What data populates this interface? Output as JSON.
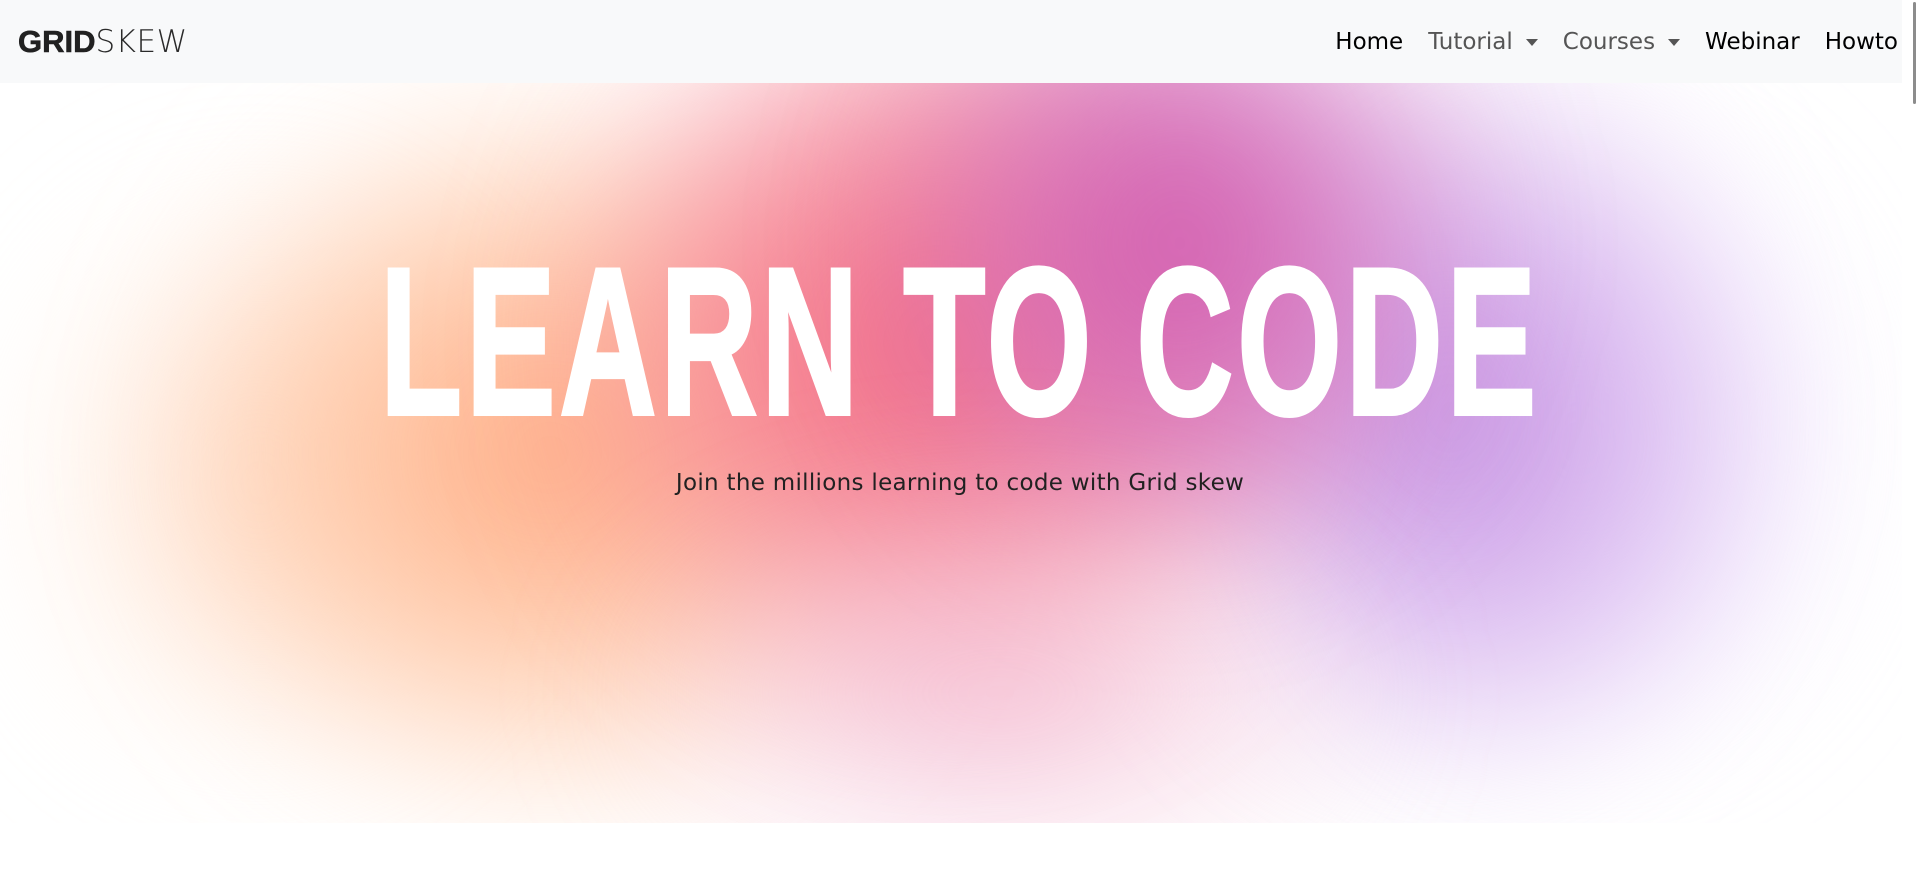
{
  "navbar": {
    "brand_bold": "GRID",
    "brand_light": "SKEW",
    "links": [
      {
        "label": "Home",
        "dropdown": false
      },
      {
        "label": "Tutorial",
        "dropdown": true
      },
      {
        "label": "Courses",
        "dropdown": true
      },
      {
        "label": "Webinar",
        "dropdown": false
      },
      {
        "label": "Howto",
        "dropdown": false
      }
    ]
  },
  "hero": {
    "title": "LEARN TO CODE",
    "subtitle": "Join the millions learning to code with Grid skew",
    "gradient_colors": [
      "#ffa378",
      "#f05a78",
      "#cd50aa",
      "#be82dc",
      "#e1cdfa"
    ]
  },
  "icons": {
    "dropdown": "caret-down-icon"
  }
}
